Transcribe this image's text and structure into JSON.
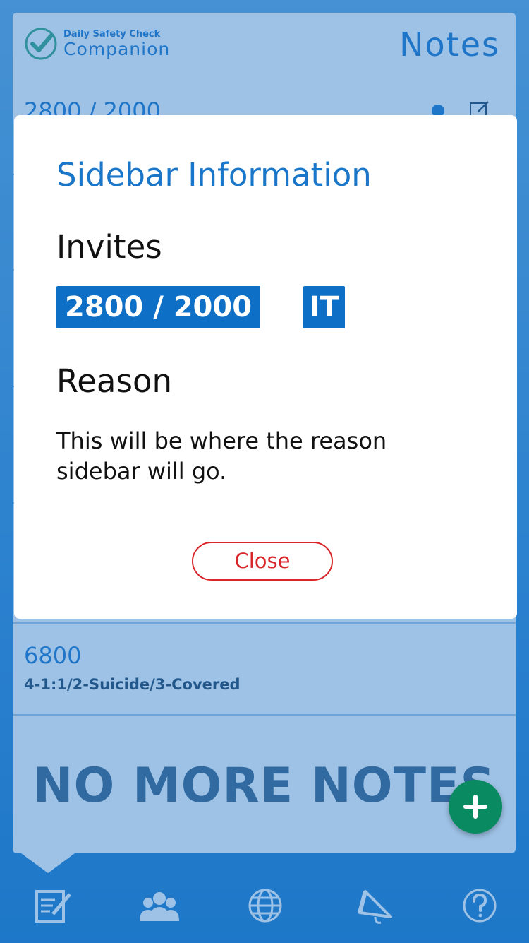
{
  "header": {
    "brand_small": "Daily Safety Check",
    "brand_big": "Companion",
    "page_title": "Notes"
  },
  "notes": [
    {
      "title": "2800 / 2000",
      "subtitle": ""
    },
    {
      "title": "6800",
      "subtitle": "4-1:1/2-Suicide/3-Covered"
    }
  ],
  "list_footer": "NO MORE NOTES",
  "modal": {
    "title": "Sidebar Information",
    "invites_label": "Invites",
    "invite_chips": [
      "2800 / 2000",
      "IT"
    ],
    "reason_label": "Reason",
    "reason_text": "This will be where the reason sidebar will go.",
    "close_label": "Close"
  },
  "tabs": [
    {
      "icon": "notes-icon"
    },
    {
      "icon": "people-icon"
    },
    {
      "icon": "globe-icon"
    },
    {
      "icon": "megaphone-icon"
    },
    {
      "icon": "help-icon"
    }
  ],
  "colors": {
    "accent": "#1976c8",
    "chip": "#0d70c6",
    "close": "#d9262a",
    "fab": "#0a8a60"
  }
}
